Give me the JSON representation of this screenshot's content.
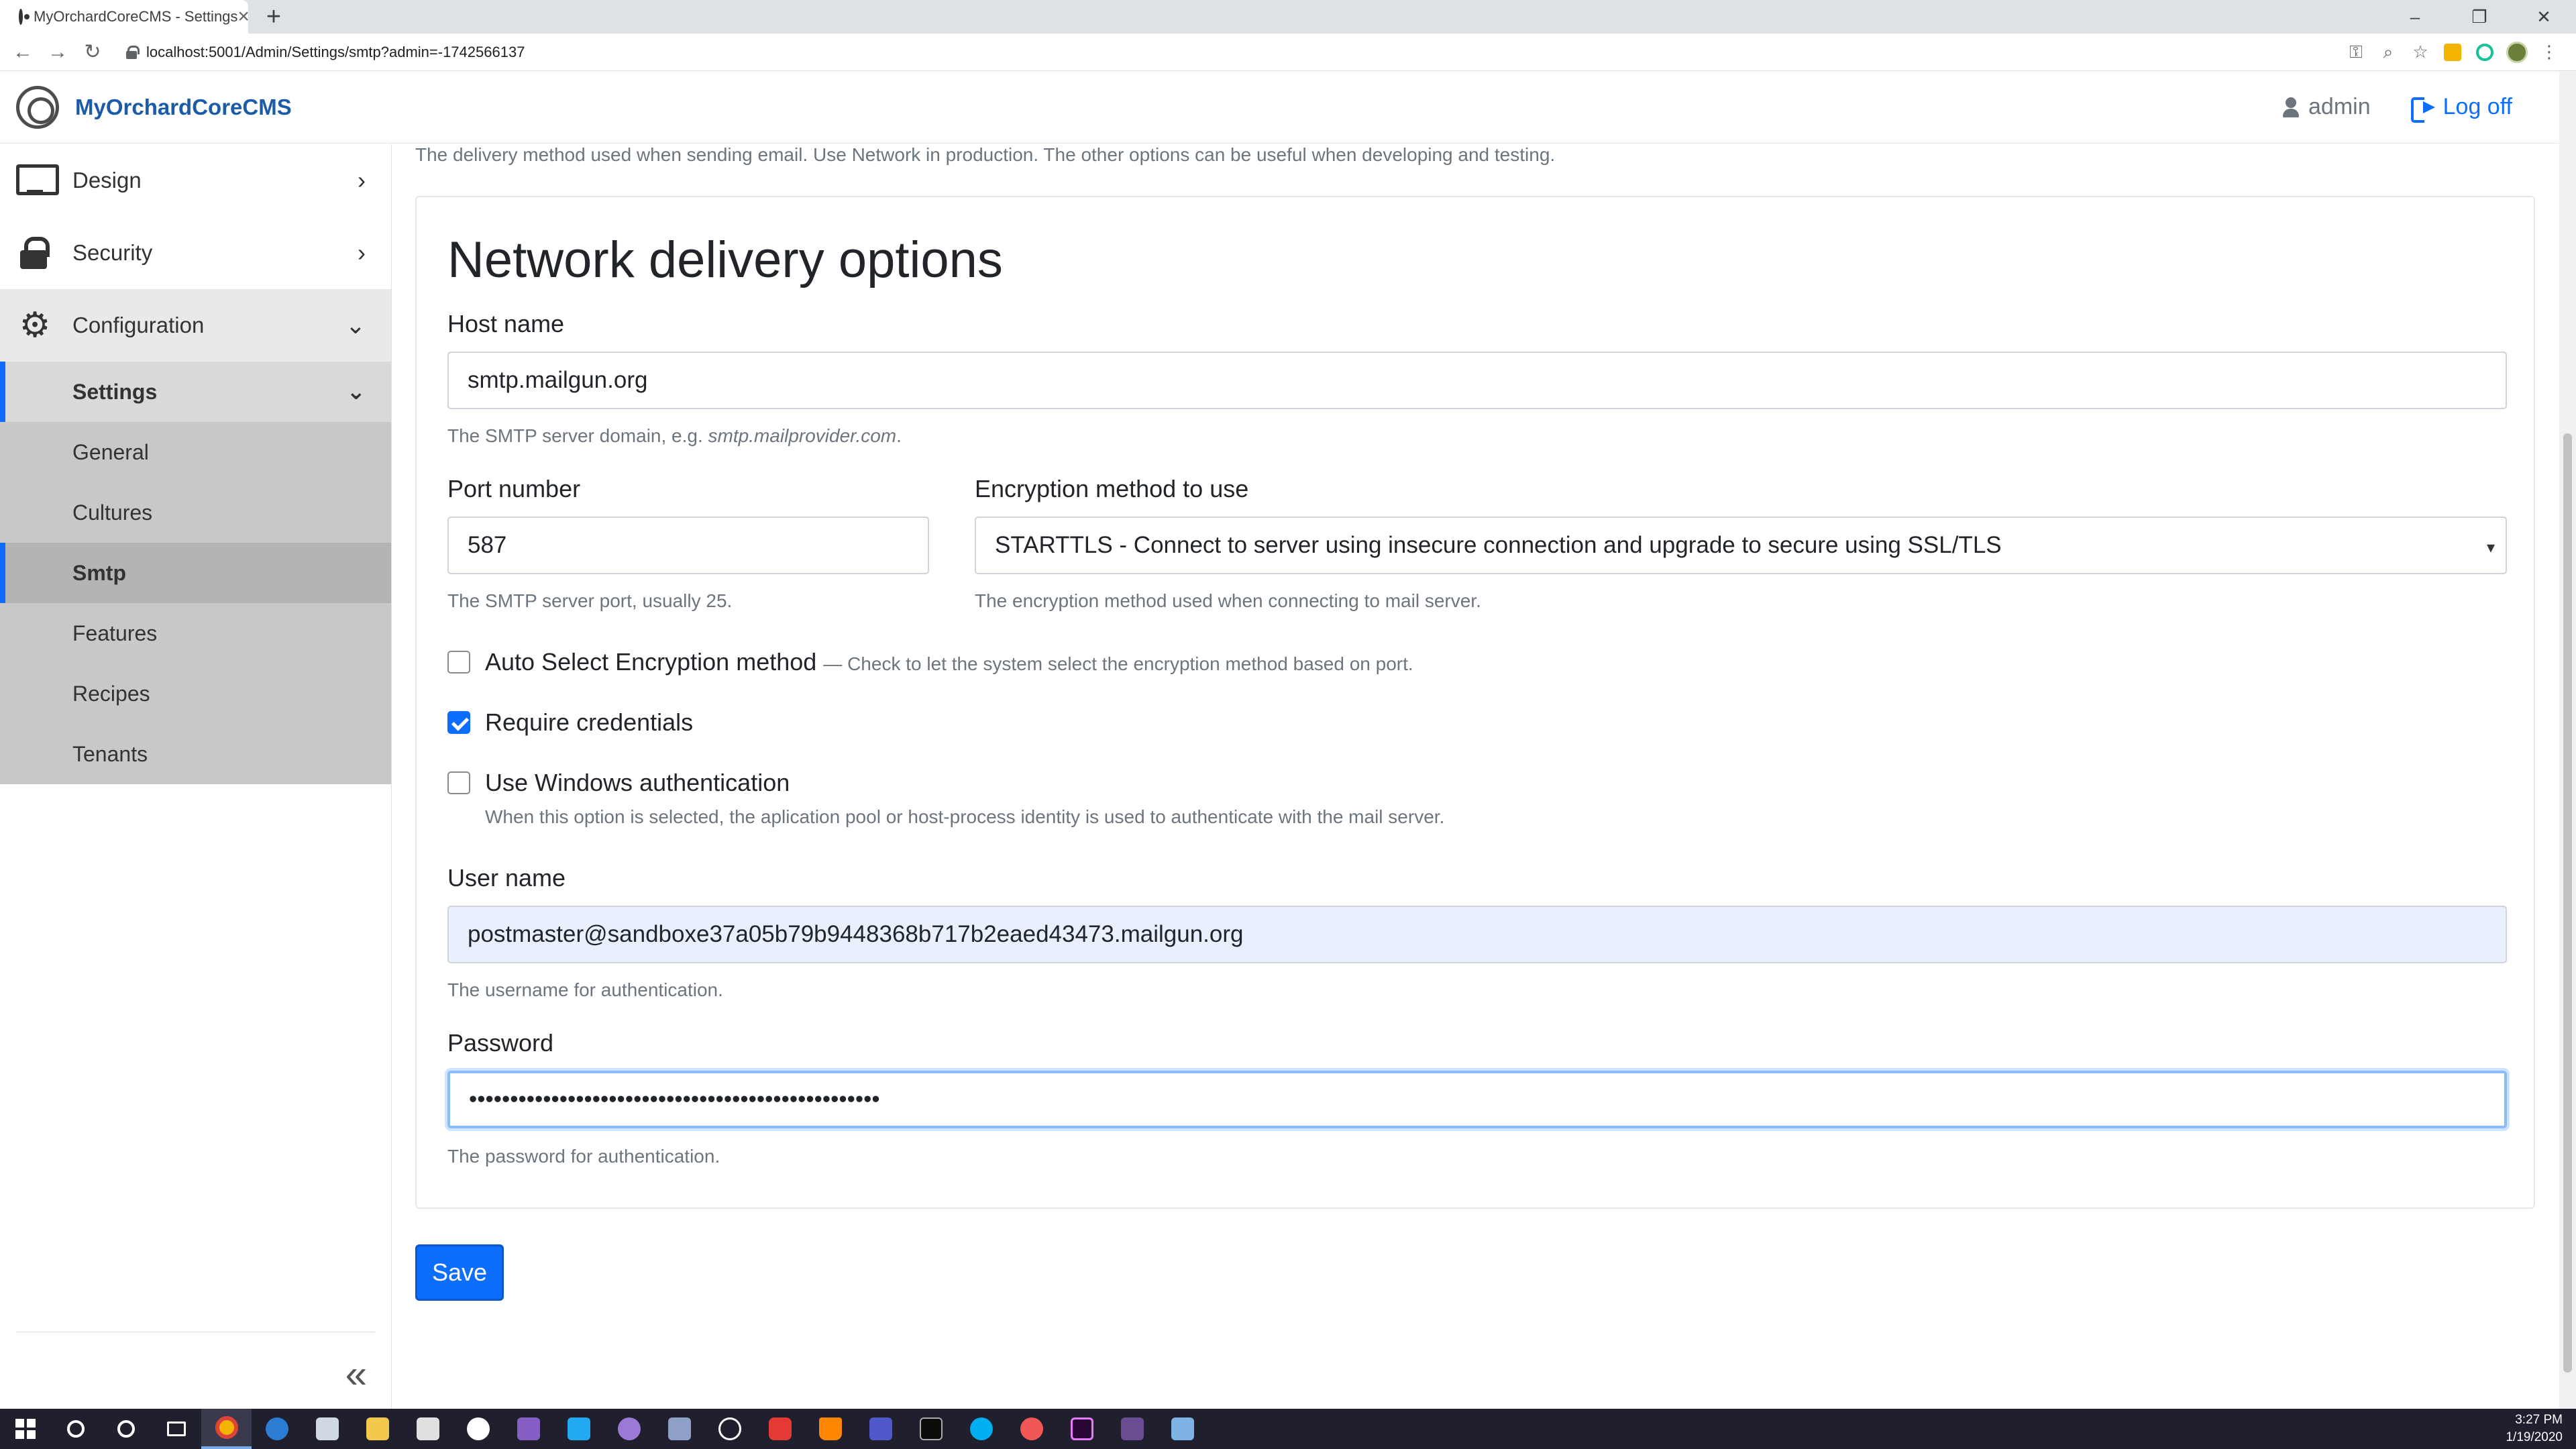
{
  "browser": {
    "tab_title": "MyOrchardCoreCMS - Settings",
    "tab_close": "×",
    "new_tab": "+",
    "url": "localhost:5001/Admin/Settings/smtp?admin=-1742566137",
    "back": "←",
    "forward": "→",
    "reload": "↻",
    "minimize": "–",
    "restore": "❐",
    "close": "✕"
  },
  "header": {
    "brand": "MyOrchardCoreCMS",
    "user": "admin",
    "logoff": "Log off"
  },
  "sidebar": {
    "items": [
      {
        "label": "Design",
        "chevron": "›"
      },
      {
        "label": "Security",
        "chevron": "›"
      },
      {
        "label": "Configuration",
        "chevron": "⌄"
      }
    ],
    "settings_label": "Settings",
    "settings_chevron": "⌄",
    "sub_items": [
      "General",
      "Cultures",
      "Smtp",
      "Features",
      "Recipes",
      "Tenants"
    ],
    "collapse": "«"
  },
  "main": {
    "delivery_help": "The delivery method used when sending email. Use Network in production. The other options can be useful when developing and testing.",
    "panel_title": "Network delivery options",
    "host": {
      "label": "Host name",
      "value": "smtp.mailgun.org",
      "help_prefix": "The SMTP server domain, e.g. ",
      "help_example": "smtp.mailprovider.com",
      "help_suffix": "."
    },
    "port": {
      "label": "Port number",
      "value": "587",
      "help": "The SMTP server port, usually 25."
    },
    "encryption": {
      "label": "Encryption method to use",
      "value": "STARTTLS - Connect to server using insecure connection and upgrade to secure using SSL/TLS",
      "arrow": "▾",
      "help": "The encryption method used when connecting to mail server."
    },
    "auto_select": {
      "label": "Auto Select Encryption method",
      "help": "— Check to let the system select the encryption method based on port.",
      "checked": false
    },
    "require_credentials": {
      "label": "Require credentials",
      "checked": true
    },
    "windows_auth": {
      "label": "Use Windows authentication",
      "help": "When this option is selected, the aplication pool or host-process identity is used to authenticate with the mail server.",
      "checked": false
    },
    "username": {
      "label": "User name",
      "value": "postmaster@sandboxe37a05b79b9448368b717b2eaed43473.mailgun.org",
      "help": "The username for authentication."
    },
    "password": {
      "label": "Password",
      "value": "••••••••••••••••••••••••••••••••••••••••••••••••••",
      "help": "The password for authentication."
    },
    "save": "Save"
  },
  "taskbar": {
    "time": "3:27 PM",
    "date": "1/19/2020"
  },
  "colors": {
    "primary": "#0d6efd",
    "brand": "#1c5ba8"
  }
}
